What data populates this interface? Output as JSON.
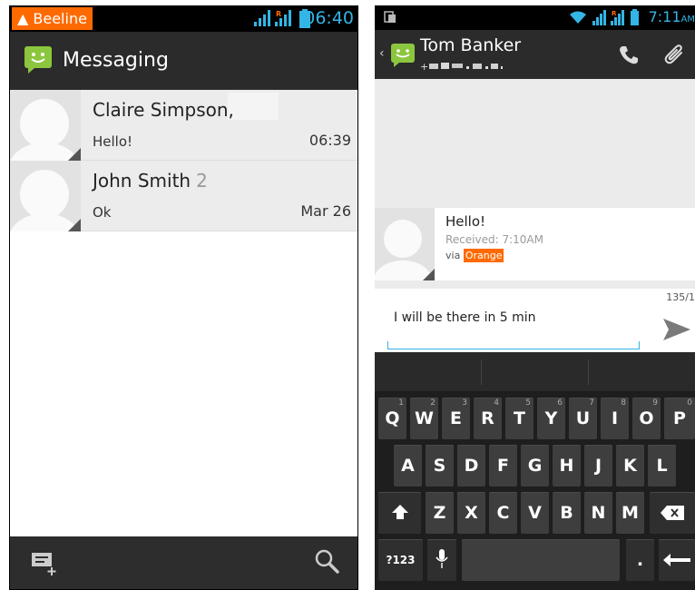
{
  "left_screen": {
    "status": {
      "carrier": "Beeline",
      "time": "06:40"
    },
    "app_title": "Messaging",
    "conversations": [
      {
        "name": "Claire Simpson,",
        "count": "",
        "snippet": "Hello!",
        "time": "06:39"
      },
      {
        "name": "John Smith",
        "count": "2",
        "snippet": "Ok",
        "time": "Mar 26"
      }
    ],
    "bottom_icons": [
      "new-message-icon",
      "search-icon"
    ]
  },
  "right_screen": {
    "status": {
      "time": "7:11",
      "ampm": "AM"
    },
    "contact_name": "Tom Banker",
    "contact_number": "+(blurred number)",
    "message": {
      "text": "Hello!",
      "received": "Received: 7:10AM",
      "via_label": "via",
      "operator": "Orange"
    },
    "compose": {
      "counter": "135/1",
      "value": "I will be there in 5 min"
    },
    "keyboard": {
      "row1": [
        "Q",
        "W",
        "E",
        "R",
        "T",
        "Y",
        "U",
        "I",
        "O",
        "P"
      ],
      "row1_nums": [
        "1",
        "2",
        "3",
        "4",
        "5",
        "6",
        "7",
        "8",
        "9",
        "0"
      ],
      "row2": [
        "A",
        "S",
        "D",
        "F",
        "G",
        "H",
        "J",
        "K",
        "L"
      ],
      "row3": [
        "Z",
        "X",
        "C",
        "V",
        "B",
        "N",
        "M"
      ],
      "symbols_key": "?123",
      "period_key": "."
    },
    "colors": {
      "accent": "#33b5e5",
      "operator": "#ff6a00"
    }
  }
}
